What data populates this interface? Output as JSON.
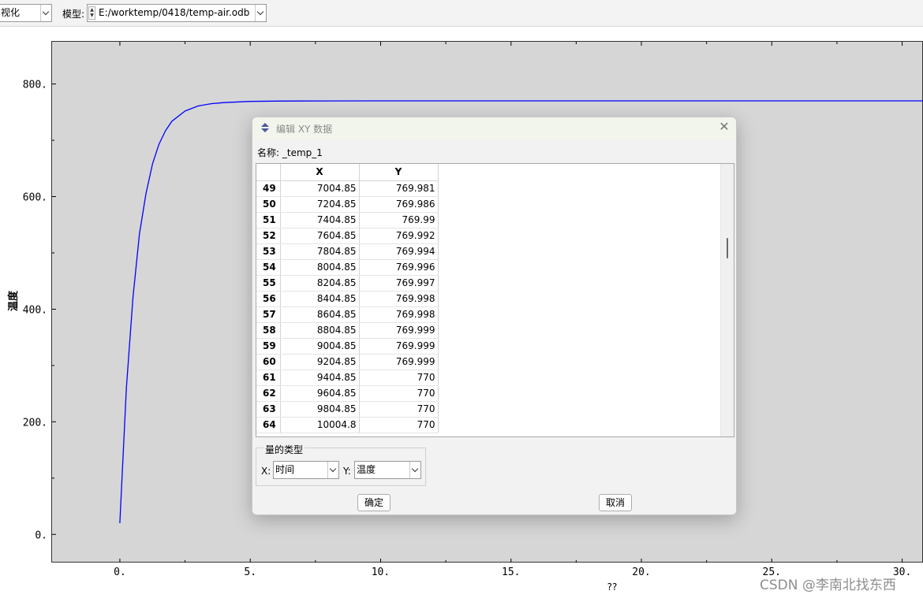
{
  "toolbar": {
    "module_combo_value": "视化",
    "model_label": "模型:",
    "model_combo_value": "E:/worktemp/0418/temp-air.odb"
  },
  "chart_data": {
    "type": "line",
    "xlabel": "??",
    "ylabel": "温度",
    "xlim": [
      -2.6,
      30.8
    ],
    "ylim": [
      -50,
      875
    ],
    "x_ticks": [
      0,
      5,
      10,
      15,
      20,
      25,
      30
    ],
    "x_tick_labels": [
      "0.",
      "5.",
      "10.",
      "15.",
      "20.",
      "25.",
      "30."
    ],
    "y_ticks": [
      0,
      200,
      400,
      600,
      800
    ],
    "y_tick_labels": [
      "0.",
      "200.",
      "400.",
      "600.",
      "800."
    ],
    "series": [
      {
        "color": "#0000ff",
        "x": [
          0,
          0.25,
          0.5,
          0.75,
          1.0,
          1.25,
          1.5,
          1.75,
          2.0,
          2.5,
          3.0,
          3.5,
          4.0,
          5.0,
          6.0,
          8.0,
          10.0,
          15.0,
          20.0,
          25.0,
          30.8
        ],
        "y": [
          20,
          260,
          420,
          533,
          605,
          658,
          693,
          717,
          734,
          752,
          761,
          765,
          767,
          769,
          769.6,
          769.9,
          770,
          770,
          770,
          770,
          770
        ]
      }
    ]
  },
  "dialog": {
    "title": "编辑 XY 数据",
    "name_label": "名称:",
    "name_value": "_temp_1",
    "col_x": "X",
    "col_y": "Y",
    "rows": [
      {
        "n": "49",
        "x": "7004.85",
        "y": "769.981"
      },
      {
        "n": "50",
        "x": "7204.85",
        "y": "769.986"
      },
      {
        "n": "51",
        "x": "7404.85",
        "y": "769.99"
      },
      {
        "n": "52",
        "x": "7604.85",
        "y": "769.992"
      },
      {
        "n": "53",
        "x": "7804.85",
        "y": "769.994"
      },
      {
        "n": "54",
        "x": "8004.85",
        "y": "769.996"
      },
      {
        "n": "55",
        "x": "8204.85",
        "y": "769.997"
      },
      {
        "n": "56",
        "x": "8404.85",
        "y": "769.998"
      },
      {
        "n": "57",
        "x": "8604.85",
        "y": "769.998"
      },
      {
        "n": "58",
        "x": "8804.85",
        "y": "769.999"
      },
      {
        "n": "59",
        "x": "9004.85",
        "y": "769.999"
      },
      {
        "n": "60",
        "x": "9204.85",
        "y": "769.999"
      },
      {
        "n": "61",
        "x": "9404.85",
        "y": "770"
      },
      {
        "n": "62",
        "x": "9604.85",
        "y": "770"
      },
      {
        "n": "63",
        "x": "9804.85",
        "y": "770"
      },
      {
        "n": "64",
        "x": "10004.8",
        "y": "770"
      }
    ],
    "group_title": "量的类型",
    "x_label": "X:",
    "x_value": "时间",
    "y_label": "Y:",
    "y_value": "温度",
    "ok_label": "确定",
    "cancel_label": "取消"
  },
  "watermark": "CSDN @李南北找东西"
}
